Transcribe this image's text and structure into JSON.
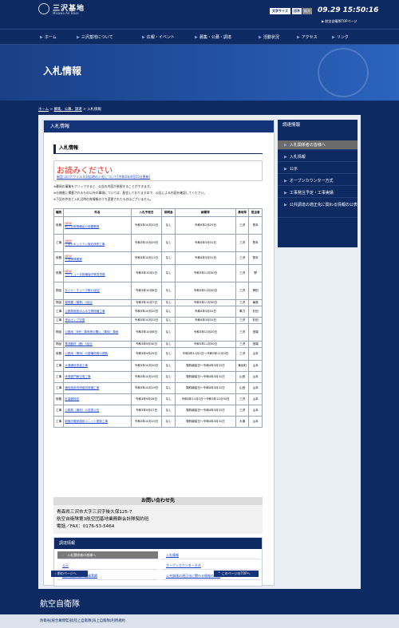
{
  "header": {
    "logo_title": "三沢基地",
    "logo_sub": "Misawa Air Base",
    "font_label": "文字サイズ",
    "font_std": "標準",
    "font_large": "拡大",
    "clock": "09.29 15:50:16",
    "top_link": "航空自衛隊TOPページ"
  },
  "nav": [
    "ホーム",
    "三沢基地について",
    "広報・イベント",
    "募集・公募・調達",
    "活動状況",
    "アクセス",
    "リンク"
  ],
  "hero_title": "入札情報",
  "breadcrumb": {
    "home": "ホーム",
    "sep": " > ",
    "b2": "募集、公募、調達",
    "b3": "入札情報"
  },
  "main_bar": "入札情報",
  "section_title": "入札情報",
  "notice": {
    "title": "お読みください",
    "link": "新型コロナウイルス対応時の入札について[令和2年4月15日更新]"
  },
  "notes": [
    "※静岡の事業をクリックすると、公告の内容が参照することができます。",
    "※仕様書に掲載されるもの以外の事項については、配信しておりますので、公告による内容を確認してください。",
    "※下記の件名と入札日時の各情報のうち変更されたものはございません。"
  ],
  "table": {
    "headers": [
      "種別",
      "件名",
      "入札予定日",
      "説明会",
      "納期等",
      "基地等",
      "担当者"
    ],
    "rows": [
      {
        "type": "役務",
        "title": "他上自衛隊備品の設置業務",
        "new": "NEW",
        "date": "令和3年10月22日",
        "brief": "なし",
        "term": "令和4年2月25日",
        "base": "三沢",
        "person": "笹本"
      },
      {
        "type": "工事",
        "title": "庁舎セキュリティ強化改修工事",
        "new": "NEW",
        "date": "令和3年10月29日",
        "brief": "なし",
        "term": "令和4年3月31日",
        "base": "三沢",
        "person": "笹本"
      },
      {
        "type": "役務",
        "title": "庁舎清掃業務",
        "new": "NEW",
        "date": "令和3年10月11日",
        "brief": "なし",
        "term": "令和4年3月31日",
        "base": "三沢",
        "person": "笹本"
      },
      {
        "type": "役務",
        "title": "コンピュータ設備保守等賃貸借",
        "new": "NEW",
        "date": "令和3年10月1日",
        "brief": "なし",
        "term": "令和3年11月30日",
        "base": "三沢",
        "person": "野"
      },
      {
        "type": "物品",
        "title": "タイヤ・チューブ等10品目",
        "new": "",
        "date": "令和3年10月8日",
        "brief": "なし",
        "term": "令和3年11月30日",
        "base": "三沢",
        "person": "神田"
      },
      {
        "type": "物品",
        "title": "寝具類（寝具）9品目",
        "new": "",
        "date": "令和3年10月7日",
        "brief": "なし",
        "term": "令和3年11月30日",
        "base": "三沢",
        "person": "篠島"
      },
      {
        "type": "工事",
        "title": "公務員宿舎ほんみち等修繕工事",
        "new": "",
        "date": "令和3年10月20日",
        "brief": "なし",
        "term": "令和4年3月31日",
        "base": "車力",
        "person": "杉田"
      },
      {
        "type": "工事",
        "title": "浸水ポンプ交換",
        "new": "",
        "date": "令和3年10月22日",
        "brief": "なし",
        "term": "令和4年3月31日",
        "base": "三沢",
        "person": "杉田"
      },
      {
        "type": "物品",
        "title": "公務用（B号）車両等の購入（車体）車両",
        "new": "",
        "date": "令和3年10月6日",
        "brief": "なし",
        "term": "令和3年12月20日",
        "base": "三沢",
        "person": "田端"
      },
      {
        "type": "物品",
        "title": "電池器材（器）5品目",
        "new": "",
        "date": "令和3年9月30日",
        "brief": "なし",
        "term": "令和3年11月30日",
        "base": "三沢",
        "person": "田端"
      },
      {
        "type": "役務",
        "title": "公務用（車両）の整備役務の請負",
        "new": "",
        "date": "令和3年9月29日",
        "brief": "なし",
        "term": "令和3年11月1日～令和3年11月3日",
        "base": "三沢",
        "person": "山本"
      },
      {
        "type": "工事",
        "title": "大湊通信塗装工事",
        "new": "",
        "date": "令和3年10月20日",
        "brief": "なし",
        "term": "契約締結日～令和4年3月31日",
        "base": "東北町",
        "person": "山本"
      },
      {
        "type": "工事",
        "title": "体育館門扉交換工事",
        "new": "",
        "date": "令和3年10月19日",
        "brief": "なし",
        "term": "契約締結日～令和4年3月31日",
        "base": "山田",
        "person": "山本"
      },
      {
        "type": "工事",
        "title": "通信施設改修維持修繕工事",
        "new": "",
        "date": "令和3年10月19日",
        "brief": "なし",
        "term": "契約締結日～令和4年3月31日",
        "base": "山田",
        "person": "山本"
      },
      {
        "type": "役務",
        "title": "計量器検定",
        "new": "",
        "date": "令和3年9月28日",
        "brief": "なし",
        "term": "令和3年11月1日～令和3年11月30日",
        "base": "三沢",
        "person": "山本"
      },
      {
        "type": "工事",
        "title": "公務員（機材）の変更公告",
        "new": "",
        "date": "令和3年9月27日",
        "brief": "なし",
        "term": "契約締結日～令和4年3月31日",
        "base": "三沢",
        "person": "山本"
      },
      {
        "type": "工事",
        "title": "新築冷蔵室施設ユニット更新工事",
        "new": "",
        "date": "令和3年10月15日",
        "brief": "なし",
        "term": "契約締結日～令和4年3月31日",
        "base": "大湊",
        "person": "山本"
      }
    ]
  },
  "contact": {
    "title": "お問い合わせ先",
    "line1": "青森県三沢市大字三沢字後久保125-7",
    "line2": "航空自衛隊第3航空団基地業務群会計隊契約班",
    "line3": "電話／FAX：0176-53-5464"
  },
  "inner_nav": {
    "title": "調達情報",
    "items": [
      "入札関係者の皆様へ",
      "入札情報",
      "公示",
      "オープンカウンター方式",
      "工事発注予定・工事実績",
      "公共調達の適正化に関わる情報の公表"
    ]
  },
  "sidebar": {
    "title": "調達情報",
    "items": [
      "入札関係者の皆様へ",
      "入札情報",
      "公示",
      "オープンカウンター方式",
      "工事発注予定・工事実績",
      "公共調達の適正化に関わる情報の公表"
    ]
  },
  "prev_button": "前のページへ",
  "top_button": "このページのTOPへ",
  "footer": {
    "title": "航空自衛隊",
    "links": "防衛省|統合幕僚監部|陸上自衛隊|海上自衛隊|利用規約"
  }
}
